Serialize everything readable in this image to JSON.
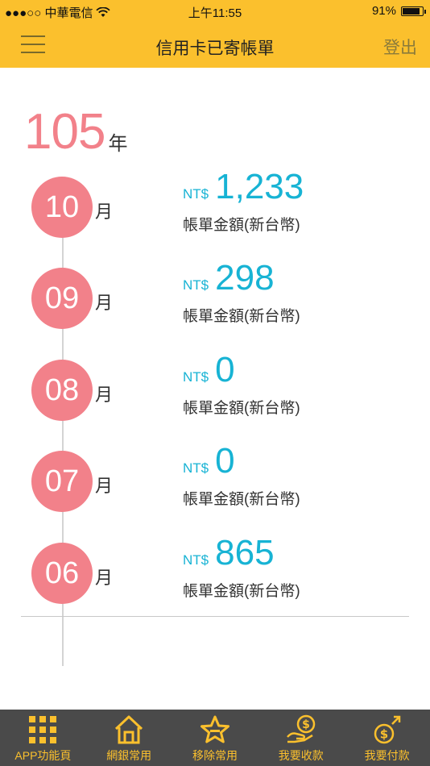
{
  "status": {
    "carrier": "●●●○○ 中華電信",
    "time": "上午11:55",
    "battery": "91%",
    "battery_level": 0.91
  },
  "nav": {
    "title": "信用卡已寄帳單",
    "logout": "登出"
  },
  "year": {
    "value": "105",
    "unit": "年"
  },
  "bills": [
    {
      "month": "10",
      "unit": "月",
      "currency": "NT$",
      "amount": "1,233",
      "label": "帳單金額(新台幣)"
    },
    {
      "month": "09",
      "unit": "月",
      "currency": "NT$",
      "amount": "298",
      "label": "帳單金額(新台幣)"
    },
    {
      "month": "08",
      "unit": "月",
      "currency": "NT$",
      "amount": "0",
      "label": "帳單金額(新台幣)"
    },
    {
      "month": "07",
      "unit": "月",
      "currency": "NT$",
      "amount": "0",
      "label": "帳單金額(新台幣)"
    },
    {
      "month": "06",
      "unit": "月",
      "currency": "NT$",
      "amount": "865",
      "label": "帳單金額(新台幣)"
    }
  ],
  "tabs": [
    {
      "label": "APP功能頁",
      "icon": "grid-icon"
    },
    {
      "label": "網銀常用",
      "icon": "home-icon"
    },
    {
      "label": "移除常用",
      "icon": "star-icon"
    },
    {
      "label": "我要收款",
      "icon": "receive-money-icon"
    },
    {
      "label": "我要付款",
      "icon": "pay-money-icon"
    }
  ],
  "colors": {
    "header": "#fbc02d",
    "accent_pink": "#f2818a",
    "amount_blue": "#17b3d4",
    "tab_bar": "#4a4a4a"
  }
}
